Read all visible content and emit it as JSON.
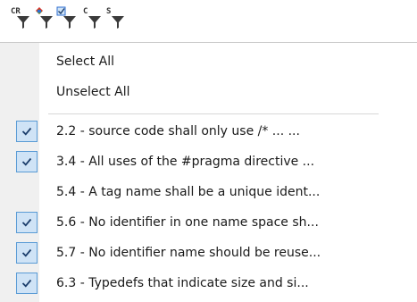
{
  "toolbar": {
    "buttons": [
      {
        "letters": "CR",
        "icon": "filter-cr-icon"
      },
      {
        "letters": "",
        "icon": "filter-color-icon"
      },
      {
        "letters": "",
        "icon": "filter-checked-icon"
      },
      {
        "letters": "C",
        "icon": "filter-c-icon"
      },
      {
        "letters": "S",
        "icon": "filter-s-icon"
      }
    ]
  },
  "menu": {
    "select_all": "Select All",
    "unselect_all": "Unselect All",
    "items": [
      {
        "label": "2.2 - source code shall only use /* ... ...",
        "checked": true
      },
      {
        "label": "3.4 - All uses of the #pragma directive ...",
        "checked": true
      },
      {
        "label": "5.4 - A tag name shall be a unique ident...",
        "checked": false
      },
      {
        "label": "5.6 - No identifier in one name space sh...",
        "checked": true
      },
      {
        "label": "5.7 - No identifier name should be reuse...",
        "checked": true
      },
      {
        "label": "6.3 - Typedefs that indicate size and si...",
        "checked": true
      }
    ]
  },
  "colors": {
    "check_bg": "#cfe3f6",
    "check_border": "#5a9bd5",
    "check_mark": "#1b3d6b",
    "filter_red": "#d9332b",
    "filter_green": "#3aa13a",
    "filter_blue": "#2f6fd1"
  }
}
